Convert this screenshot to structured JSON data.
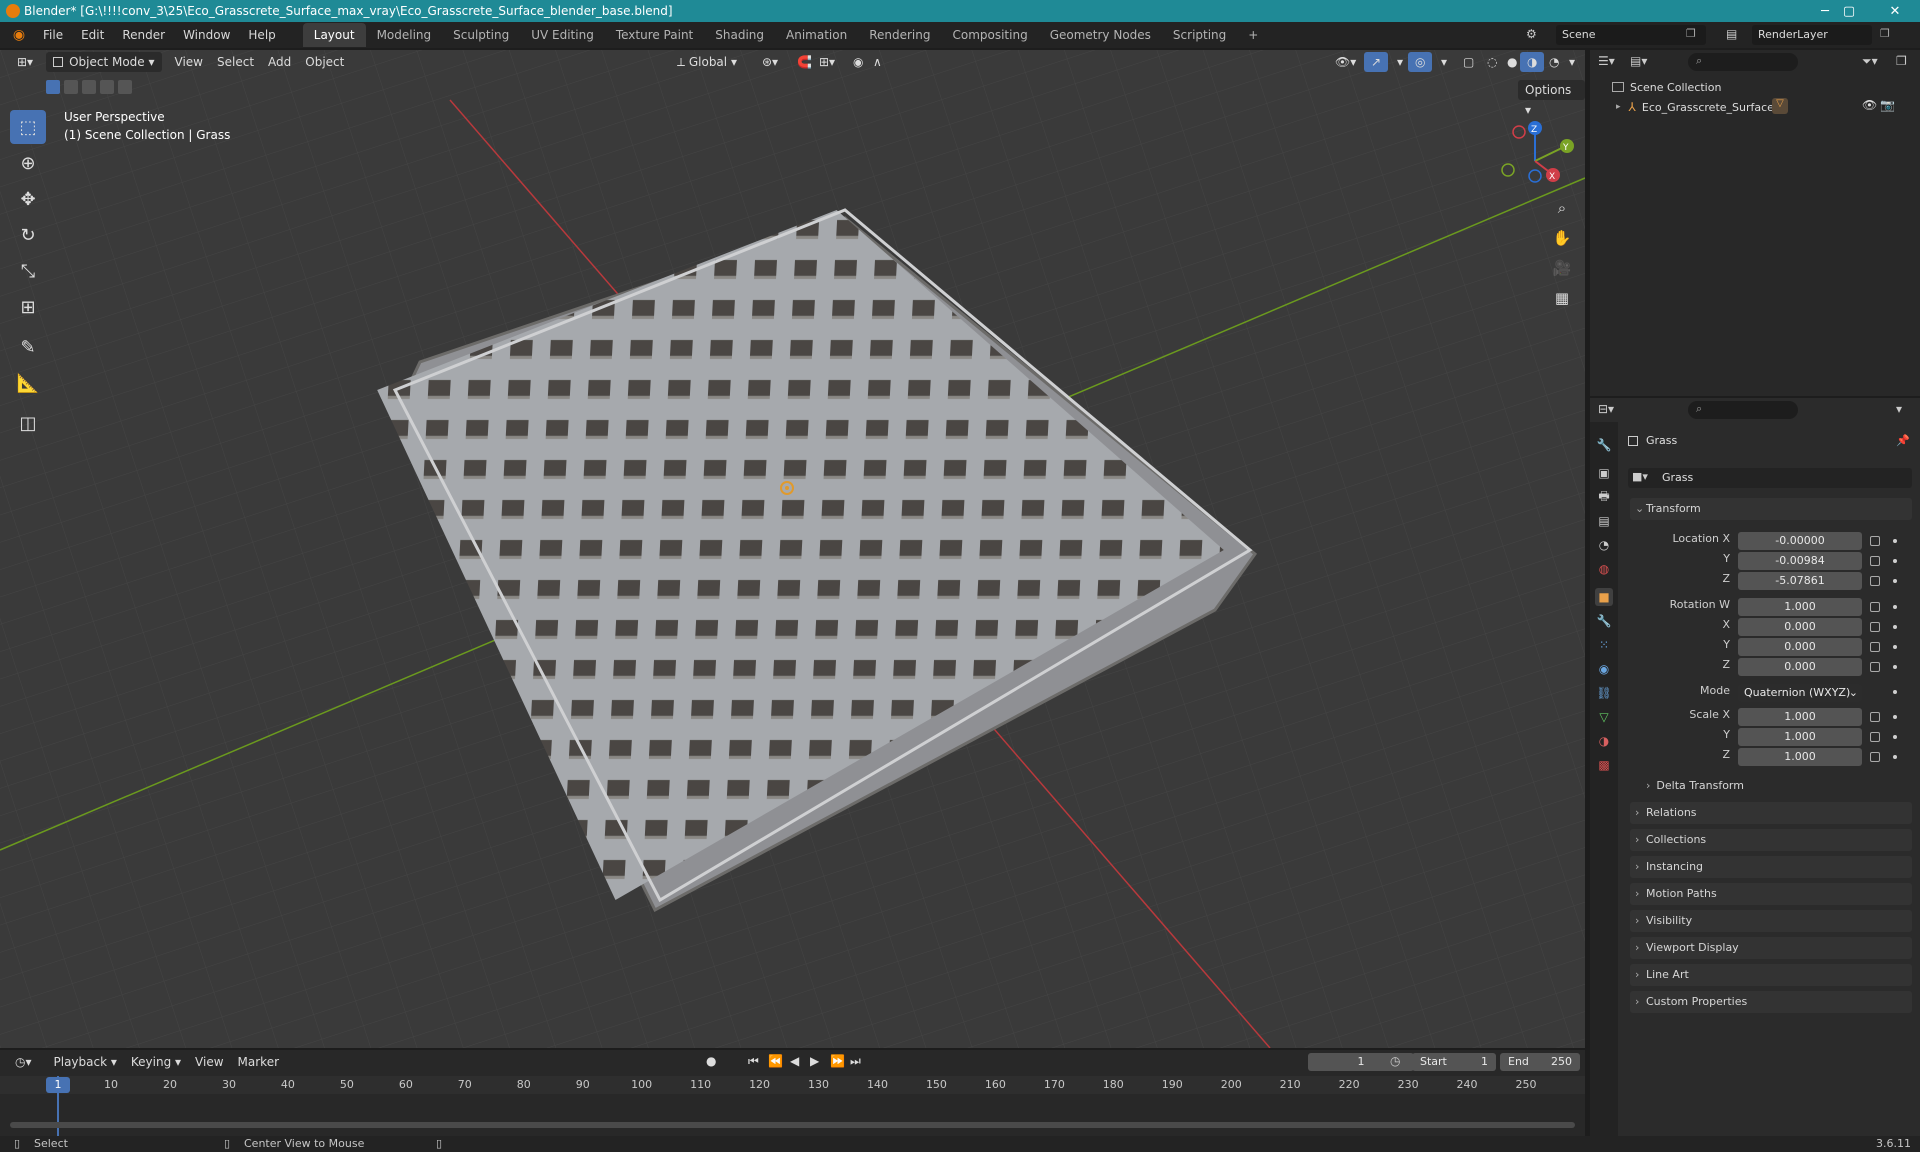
{
  "window": {
    "title": "Blender* [G:\\!!!!conv_3\\25\\Eco_Grasscrete_Surface_max_vray\\Eco_Grasscrete_Surface_blender_base.blend]",
    "minimize": "─",
    "maximize": "▢",
    "close": "✕"
  },
  "menu": [
    "File",
    "Edit",
    "Render",
    "Window",
    "Help"
  ],
  "workspaces": [
    "Layout",
    "Modeling",
    "Sculpting",
    "UV Editing",
    "Texture Paint",
    "Shading",
    "Animation",
    "Rendering",
    "Compositing",
    "Geometry Nodes",
    "Scripting",
    "+"
  ],
  "scene": {
    "name": "Scene",
    "view_layer": "RenderLayer"
  },
  "viewport": {
    "mode": "Object Mode",
    "menus": [
      "View",
      "Select",
      "Add",
      "Object"
    ],
    "transform_orientation": "Global",
    "options_label": "Options",
    "perspective": "User Perspective",
    "collection_info": "(1) Scene Collection | Grass",
    "gizmo_axes": {
      "z": "Z",
      "y": "Y",
      "x": "X"
    }
  },
  "outliner": {
    "root": "Scene Collection",
    "items": [
      {
        "name": "Eco_Grasscrete_Surface"
      }
    ]
  },
  "properties": {
    "object_name": "Grass",
    "data_name": "Grass",
    "transform_label": "Transform",
    "location": {
      "label_x": "Location X",
      "x": "-0.00000",
      "label_y": "Y",
      "y": "-0.00984",
      "label_z": "Z",
      "z": "-5.07861"
    },
    "rotation": {
      "label_w": "Rotation W",
      "w": "1.000",
      "label_x": "X",
      "x": "0.000",
      "label_y": "Y",
      "y": "0.000",
      "label_z": "Z",
      "z": "0.000"
    },
    "mode": {
      "label": "Mode",
      "value": "Quaternion (WXYZ)"
    },
    "scale": {
      "label_x": "Scale X",
      "x": "1.000",
      "label_y": "Y",
      "y": "1.000",
      "label_z": "Z",
      "z": "1.000"
    },
    "delta_transform": "Delta Transform",
    "panels": [
      "Relations",
      "Collections",
      "Instancing",
      "Motion Paths",
      "Visibility",
      "Viewport Display",
      "Line Art",
      "Custom Properties"
    ]
  },
  "timeline": {
    "menus": [
      "Playback",
      "Keying",
      "View",
      "Marker"
    ],
    "current_frame": "1",
    "start_label": "Start",
    "start": "1",
    "end_label": "End",
    "end": "250",
    "ruler": [
      "1",
      "10",
      "20",
      "30",
      "40",
      "50",
      "60",
      "70",
      "80",
      "90",
      "100",
      "110",
      "120",
      "130",
      "140",
      "150",
      "160",
      "170",
      "180",
      "190",
      "200",
      "210",
      "220",
      "230",
      "240",
      "250"
    ]
  },
  "statusbar": {
    "select": "Select",
    "center_view": "Center View to Mouse",
    "version": "3.6.11"
  },
  "colors": {
    "accent": "#4772b3",
    "titlebar": "#1f8a96",
    "viewport_bg": "#393939",
    "x_axis": "#c0393c",
    "y_axis": "#6b9a1e"
  }
}
